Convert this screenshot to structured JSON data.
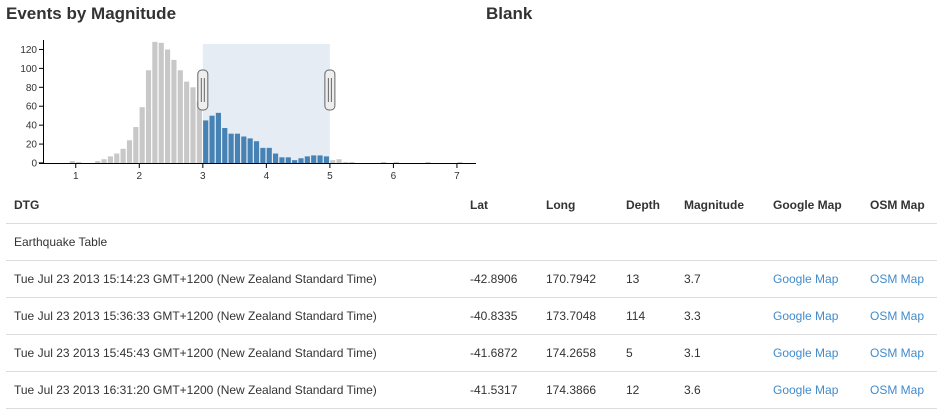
{
  "panels": {
    "left_title": "Events by Magnitude",
    "right_title": "Blank"
  },
  "colors": {
    "unselected": "#c8c8c8",
    "selected": "#4682b4",
    "brush": "#e6ecf4",
    "link": "#428bca"
  },
  "chart_data": {
    "type": "bar",
    "xlim": [
      0.5,
      7.3
    ],
    "ylim": [
      0,
      130
    ],
    "yticks": [
      0,
      20,
      40,
      60,
      80,
      100,
      120
    ],
    "xticks": [
      1,
      2,
      3,
      4,
      5,
      6,
      7
    ],
    "bin_width": 0.1,
    "brush_extent": [
      3,
      5
    ],
    "x": [
      0.4,
      0.5,
      0.6,
      0.7,
      0.8,
      0.9,
      1.0,
      1.1,
      1.2,
      1.3,
      1.4,
      1.5,
      1.6,
      1.7,
      1.8,
      1.9,
      2.0,
      2.1,
      2.2,
      2.3,
      2.4,
      2.5,
      2.6,
      2.7,
      2.8,
      2.9,
      3.0,
      3.1,
      3.2,
      3.3,
      3.4,
      3.5,
      3.6,
      3.7,
      3.8,
      3.9,
      4.0,
      4.1,
      4.2,
      4.3,
      4.4,
      4.5,
      4.6,
      4.7,
      4.8,
      4.9,
      5.0,
      5.1,
      5.2,
      5.3,
      5.4,
      5.5,
      5.6,
      5.7,
      5.8,
      5.9,
      6.0,
      6.1,
      6.2,
      6.3,
      6.4,
      6.5,
      6.6,
      6.7,
      6.8,
      6.9,
      7.0
    ],
    "values": [
      1,
      0,
      0,
      0,
      0,
      2,
      1,
      0,
      0,
      2,
      4,
      7,
      10,
      15,
      24,
      38,
      59,
      98,
      128,
      127,
      120,
      109,
      98,
      86,
      80,
      65,
      45,
      50,
      53,
      37,
      31,
      31,
      28,
      26,
      23,
      16,
      16,
      10,
      6,
      6,
      3,
      5,
      7,
      8,
      8,
      7,
      3,
      4,
      1,
      1,
      0,
      0,
      0,
      0,
      1,
      0,
      1,
      0,
      0,
      0,
      0,
      1,
      0,
      0,
      0,
      0,
      1
    ]
  },
  "table": {
    "headers": [
      "DTG",
      "Lat",
      "Long",
      "Depth",
      "Magnitude",
      "Google Map",
      "OSM Map"
    ],
    "caption": "Earthquake Table",
    "rows": [
      {
        "dtg": "Tue Jul 23 2013 15:14:23 GMT+1200 (New Zealand Standard Time)",
        "lat": "-42.8906",
        "long": "170.7942",
        "depth": "13",
        "magnitude": "3.7",
        "google": "Google Map",
        "osm": "OSM Map"
      },
      {
        "dtg": "Tue Jul 23 2013 15:36:33 GMT+1200 (New Zealand Standard Time)",
        "lat": "-40.8335",
        "long": "173.7048",
        "depth": "114",
        "magnitude": "3.3",
        "google": "Google Map",
        "osm": "OSM Map"
      },
      {
        "dtg": "Tue Jul 23 2013 15:45:43 GMT+1200 (New Zealand Standard Time)",
        "lat": "-41.6872",
        "long": "174.2658",
        "depth": "5",
        "magnitude": "3.1",
        "google": "Google Map",
        "osm": "OSM Map"
      },
      {
        "dtg": "Tue Jul 23 2013 16:31:20 GMT+1200 (New Zealand Standard Time)",
        "lat": "-41.5317",
        "long": "174.3866",
        "depth": "12",
        "magnitude": "3.6",
        "google": "Google Map",
        "osm": "OSM Map"
      }
    ]
  }
}
